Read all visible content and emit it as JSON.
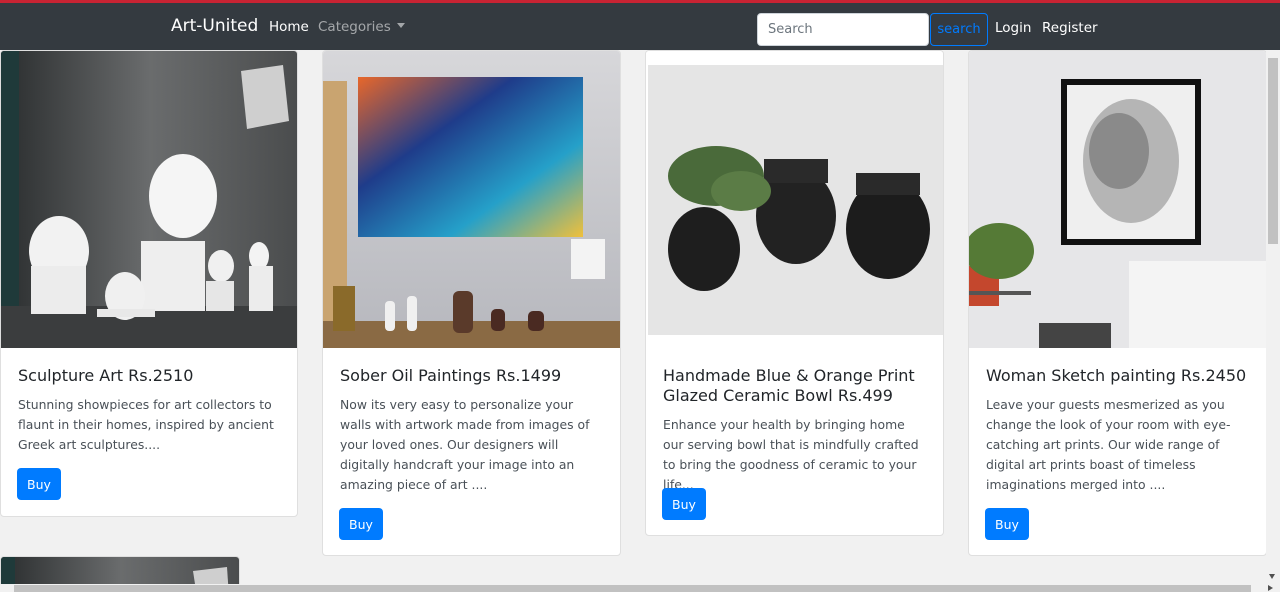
{
  "navbar": {
    "brand": "Art-United",
    "home": "Home",
    "categories": "Categories",
    "search_placeholder": "Search",
    "search_button": "search",
    "login": "Login",
    "register": "Register"
  },
  "products": [
    {
      "title": "Sculpture Art Rs.2510",
      "description": "Stunning showpieces for art collectors to flaunt in their homes, inspired by ancient Greek art sculptures....",
      "button": "Buy"
    },
    {
      "title": "Sober Oil Paintings Rs.1499",
      "description": "Now its very easy to personalize your walls with artwork made from images of your loved ones. Our designers will digitally handcraft your image into an amazing piece of art ....",
      "button": "Buy"
    },
    {
      "title": "Handmade Blue & Orange Print Glazed Ceramic Bowl Rs.499",
      "description": "Enhance your health by bringing home our serving bowl that is mindfully crafted to bring the goodness of ceramic to your life...",
      "button": "Buy"
    },
    {
      "title": "Woman Sketch painting Rs.2450",
      "description": "Leave your guests mesmerized as you change the look of your room with eye-catching art prints. Our wide range of digital art prints boast of timeless imaginations merged into ....",
      "button": "Buy"
    }
  ],
  "colors": {
    "navbar_bg": "#343a40",
    "accent": "#007bff",
    "top_line": "#c82333"
  }
}
